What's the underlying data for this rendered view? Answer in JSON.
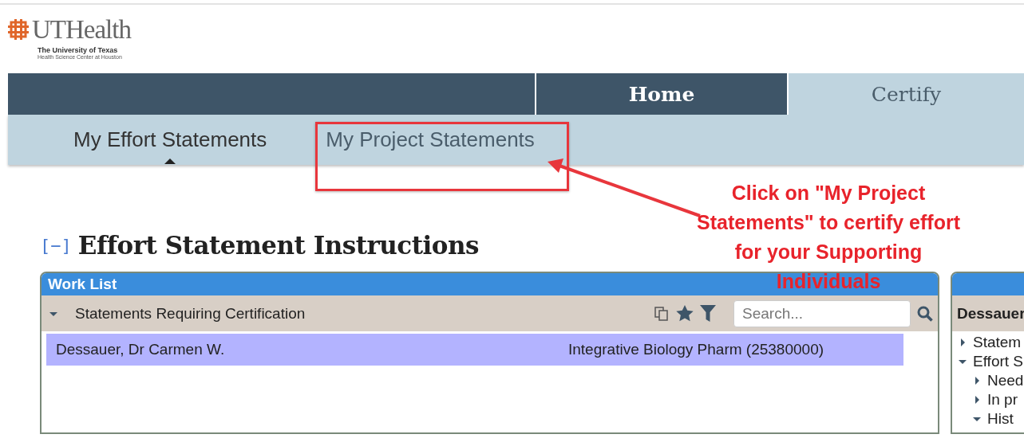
{
  "logo": {
    "name": "UTHealth",
    "line1": "The University of Texas",
    "line2": "Health Science Center at Houston"
  },
  "nav_tabs": [
    {
      "label": "Home",
      "selected": false
    },
    {
      "label": "Certify",
      "selected": true
    }
  ],
  "sub_tabs": [
    {
      "label": "My Effort Statements",
      "selected": true
    },
    {
      "label": "My Project Statements",
      "selected": false
    }
  ],
  "annotation": {
    "text": "Click on \"My Project Statements\" to certify effort for your Supporting Individuals"
  },
  "section": {
    "toggle": "[−]",
    "title": "Effort Statement Instructions",
    "expanded": true
  },
  "work_list": {
    "title": "Work List",
    "group": {
      "label": "Statements Requiring Certification",
      "expanded": true
    },
    "search": {
      "placeholder": "Search..."
    },
    "rows": [
      {
        "name": "Dessauer, Dr Carmen W.",
        "department": "Integrative Biology Pharm (25380000)",
        "selected": true
      }
    ]
  },
  "detail_panel": {
    "title": "Dessauer",
    "tree": [
      {
        "label": "Statem",
        "expanded": false
      },
      {
        "label": "Effort S",
        "expanded": true,
        "children": [
          {
            "label": "Need",
            "expanded": false
          },
          {
            "label": "In pr",
            "expanded": false
          },
          {
            "label": "Hist",
            "expanded": true
          }
        ]
      }
    ]
  }
}
